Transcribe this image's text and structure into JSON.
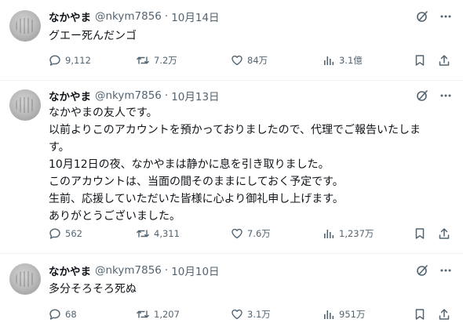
{
  "colors": {
    "text": "#0f1419",
    "secondary": "#536471",
    "divider": "#eff3f4"
  },
  "tweets": [
    {
      "name": "なかやま",
      "handle": "@nkym7856",
      "separator": "·",
      "date": "10月14日",
      "text": "グエー死んだンゴ",
      "replies": "9,112",
      "retweets": "7.2万",
      "likes": "84万",
      "views": "3.1億"
    },
    {
      "name": "なかやま",
      "handle": "@nkym7856",
      "separator": "·",
      "date": "10月13日",
      "text": "なかやまの友人です。\n以前よりこのアカウントを預かっておりましたので、代理でご報告いたしま\nす。\n10月12日の夜、なかやまは静かに息を引き取りました。\nこのアカウントは、当面の間そのままにしておく予定です。\n生前、応援していただいた皆様に心より御礼申し上げます。\nありがとうございました。",
      "replies": "562",
      "retweets": "4,311",
      "likes": "7.6万",
      "views": "1,237万"
    },
    {
      "name": "なかやま",
      "handle": "@nkym7856",
      "separator": "·",
      "date": "10月10日",
      "text": "多分そろそろ死ぬ",
      "replies": "68",
      "retweets": "1,207",
      "likes": "3.1万",
      "views": "951万"
    }
  ]
}
